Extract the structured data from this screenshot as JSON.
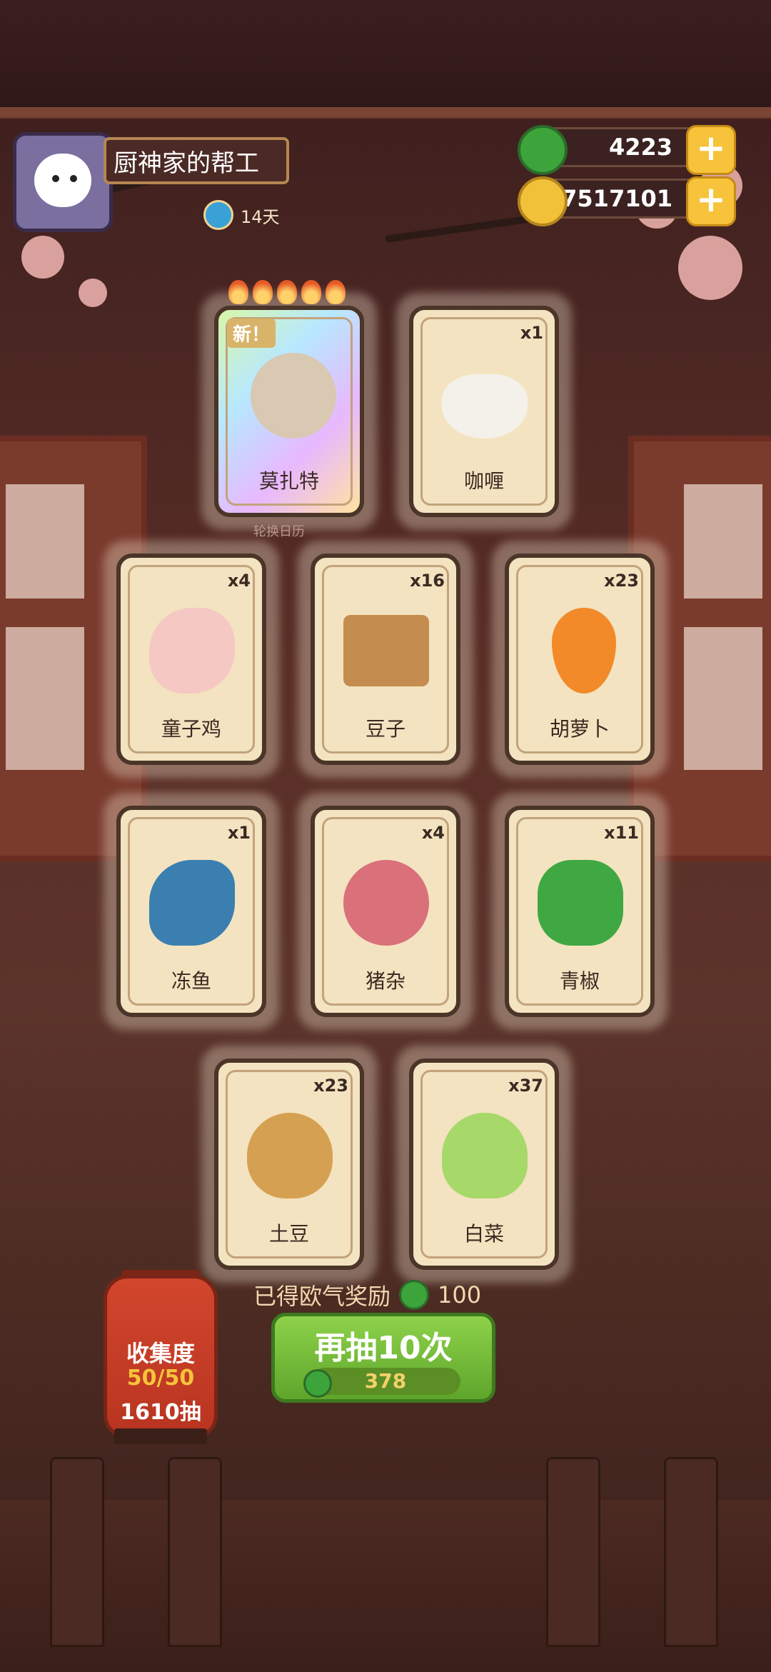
{
  "player": {
    "name": "厨神家的帮工",
    "days": "14天"
  },
  "resources": {
    "jade": "4223",
    "coins": "77517101"
  },
  "cards": [
    {
      "name": "莫扎特",
      "qty": "",
      "new_label": "新！",
      "special": true
    },
    {
      "name": "咖喱",
      "qty": "x1"
    },
    {
      "name": "童子鸡",
      "qty": "x4"
    },
    {
      "name": "豆子",
      "qty": "x16"
    },
    {
      "name": "胡萝卜",
      "qty": "x23"
    },
    {
      "name": "冻鱼",
      "qty": "x1"
    },
    {
      "name": "猪杂",
      "qty": "x4"
    },
    {
      "name": "青椒",
      "qty": "x11"
    },
    {
      "name": "土豆",
      "qty": "x23"
    },
    {
      "name": "白菜",
      "qty": "x37"
    }
  ],
  "rotation_calendar": "轮换日历",
  "lucky_reward": {
    "label": "已得欧气奖励",
    "amount": "100"
  },
  "redraw_button": {
    "label": "再抽10次",
    "cost": "378"
  },
  "collection": {
    "title": "收集度",
    "progress": "50/50",
    "draws": "1610抽"
  },
  "colors": {
    "jade": "#3ca43a",
    "coin": "#f2c13a",
    "button_green": "#6fbf36",
    "lantern_red": "#c73c24"
  },
  "icons": [
    "jade-icon",
    "coin-icon",
    "plus-icon",
    "clock-icon",
    "flame-icon"
  ]
}
